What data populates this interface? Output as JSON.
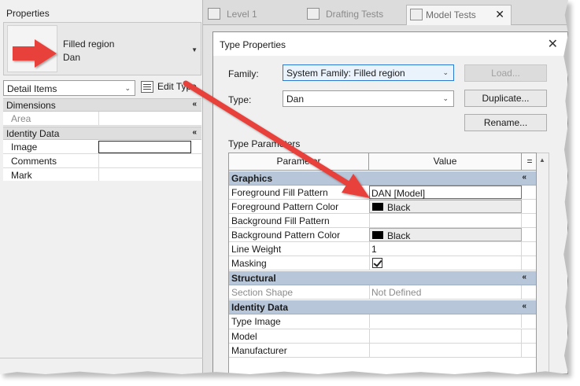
{
  "properties": {
    "title": "Properties",
    "type_family": "Filled region",
    "type_name": "Dan",
    "category": "Detail Items",
    "edit_type_label": "Edit Type",
    "sections": [
      {
        "label": "Dimensions",
        "rows": [
          {
            "name": "Area",
            "dim": true
          }
        ]
      },
      {
        "label": "Identity Data",
        "rows": [
          {
            "name": "Image"
          },
          {
            "name": "Comments"
          },
          {
            "name": "Mark"
          }
        ]
      }
    ]
  },
  "tabs": [
    {
      "label": "Level 1",
      "active": false
    },
    {
      "label": "Drafting Tests",
      "active": false
    },
    {
      "label": "Model Tests",
      "active": true
    }
  ],
  "dialog": {
    "title": "Type Properties",
    "family_label": "Family:",
    "family_value": "System Family: Filled region",
    "type_label": "Type:",
    "type_value": "Dan",
    "load_button": "Load...",
    "duplicate_button": "Duplicate...",
    "rename_button": "Rename...",
    "type_parameters_label": "Type Parameters",
    "columns": {
      "parameter": "Parameter",
      "value": "Value",
      "eq": "="
    },
    "groups": [
      {
        "label": "Graphics",
        "rows": [
          {
            "name": "Foreground Fill Pattern",
            "value": "DAN [Model]",
            "kind": "boxed"
          },
          {
            "name": "Foreground Pattern Color",
            "value": "Black",
            "kind": "color"
          },
          {
            "name": "Background Fill Pattern",
            "value": "",
            "kind": "text"
          },
          {
            "name": "Background Pattern Color",
            "value": "Black",
            "kind": "color"
          },
          {
            "name": "Line Weight",
            "value": "1",
            "kind": "text"
          },
          {
            "name": "Masking",
            "value": "",
            "kind": "check"
          }
        ]
      },
      {
        "label": "Structural",
        "rows": [
          {
            "name": "Section Shape",
            "value": "Not Defined",
            "kind": "text",
            "dim": true
          }
        ]
      },
      {
        "label": "Identity Data",
        "rows": [
          {
            "name": "Type Image",
            "value": "",
            "kind": "text"
          },
          {
            "name": "Model",
            "value": "",
            "kind": "text"
          },
          {
            "name": "Manufacturer",
            "value": "",
            "kind": "text"
          }
        ]
      }
    ]
  },
  "colors": {
    "annotation_arrow": "#e8403a",
    "group_header": "#b7c6d8",
    "focus_border": "#2b79d0"
  }
}
